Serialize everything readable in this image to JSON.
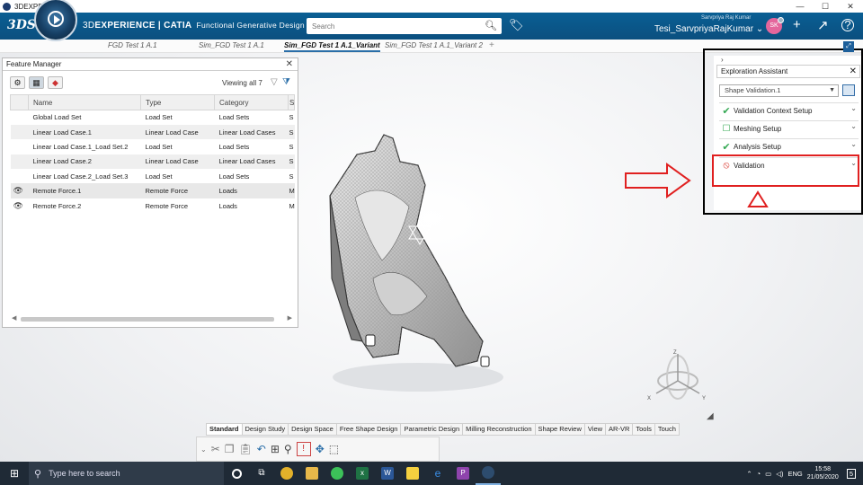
{
  "window": {
    "title": "3DEXPERIENCE",
    "controls": [
      "—",
      "☐",
      "✕"
    ]
  },
  "header": {
    "brand_light": "3D",
    "brand_bold": "EXPERIENCE | CATIA",
    "app_name": "Functional Generative Design",
    "search_placeholder": "Search",
    "user_role": "Sarvpriya Raj Kumar",
    "tenant_user": "Tesi_SarvpriyaRajKumar ⌄",
    "avatar_initials": "SK"
  },
  "tabs": [
    {
      "label": "FGD Test 1 A.1"
    },
    {
      "label": "Sim_FGD Test 1 A.1"
    },
    {
      "label": "Sim_FGD Test 1 A.1_Variant"
    },
    {
      "label": "Sim_FGD Test 1 A.1_Variant 2"
    }
  ],
  "feature_manager": {
    "title": "Feature Manager",
    "viewing": "Viewing all 7",
    "columns": [
      "Name",
      "Type",
      "Category",
      "S"
    ],
    "rows": [
      {
        "eye": "",
        "name": "Global Load Set",
        "type": "Load Set",
        "category": "Load Sets",
        "s": "S"
      },
      {
        "eye": "",
        "name": "Linear Load Case.1",
        "type": "Linear Load Case",
        "category": "Linear Load Cases",
        "s": "S"
      },
      {
        "eye": "",
        "name": "Linear Load Case.1_Load Set.2",
        "type": "Load Set",
        "category": "Load Sets",
        "s": "S"
      },
      {
        "eye": "",
        "name": "Linear Load Case.2",
        "type": "Linear Load Case",
        "category": "Linear Load Cases",
        "s": "S"
      },
      {
        "eye": "",
        "name": "Linear Load Case.2_Load Set.3",
        "type": "Load Set",
        "category": "Load Sets",
        "s": "S"
      },
      {
        "eye": "👁",
        "name": "Remote Force.1",
        "type": "Remote Force",
        "category": "Loads",
        "s": "M"
      },
      {
        "eye": "👁",
        "name": "Remote Force.2",
        "type": "Remote Force",
        "category": "Loads",
        "s": "M"
      }
    ]
  },
  "exploration_assistant": {
    "title": "Exploration Assistant",
    "selected": "Shape Validation.1",
    "steps": [
      {
        "label": "Validation Context Setup",
        "status": "✔"
      },
      {
        "label": "Meshing Setup",
        "status": "☐"
      },
      {
        "label": "Analysis Setup",
        "status": "✔"
      },
      {
        "label": "Validation",
        "status": "⦸"
      }
    ]
  },
  "action_tabs": [
    "Standard",
    "Design Study",
    "Design Space",
    "Free Shape Design",
    "Parametric Design",
    "Milling Reconstruction",
    "Shape Review",
    "View",
    "AR-VR",
    "Tools",
    "Touch"
  ],
  "triad": {
    "x": "X",
    "y": "Y",
    "z": "Z"
  },
  "taskbar": {
    "search_placeholder": "Type here to search",
    "language": "ENG",
    "time": "15:58",
    "date": "21/05/2020",
    "notifications": "5"
  },
  "colors": {
    "topbar": "#0b5588",
    "accent": "#2a6ea8",
    "annotation_red": "#e02020",
    "ok_green": "#34a853"
  }
}
